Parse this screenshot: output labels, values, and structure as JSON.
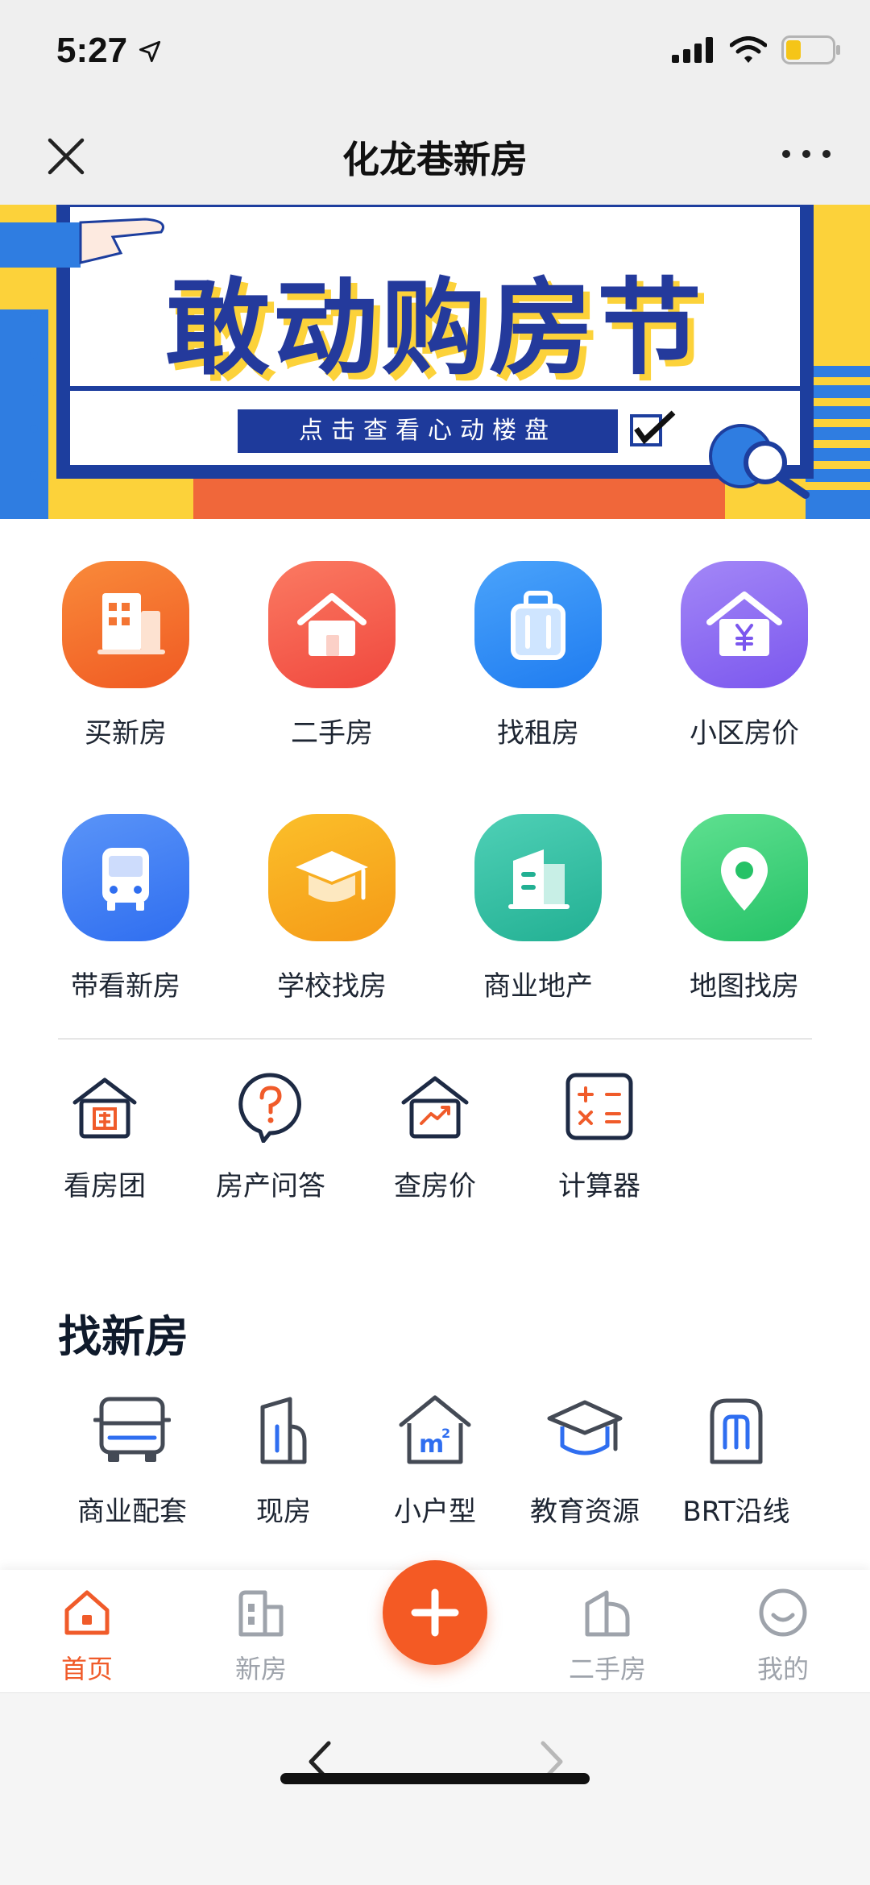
{
  "status": {
    "time": "5:27"
  },
  "nav": {
    "title": "化龙巷新房"
  },
  "banner": {
    "title": "敢动购房节",
    "subtitle": "点击查看心动楼盘"
  },
  "apps": [
    {
      "label": "买新房",
      "icon": "building-icon",
      "color": "#f46a2b"
    },
    {
      "label": "二手房",
      "icon": "house-icon",
      "color": "#f4584b"
    },
    {
      "label": "找租房",
      "icon": "suitcase-icon",
      "color": "#2d8cf5"
    },
    {
      "label": "小区房价",
      "icon": "yuan-house-icon",
      "color": "#8a68f0"
    },
    {
      "label": "带看新房",
      "icon": "bus-icon",
      "color": "#3f7cf0"
    },
    {
      "label": "学校找房",
      "icon": "graduation-cap-icon",
      "color": "#f7a21b"
    },
    {
      "label": "商业地产",
      "icon": "office-building-icon",
      "color": "#2fbfa5"
    },
    {
      "label": "地图找房",
      "icon": "map-pin-icon",
      "color": "#2fcf78"
    }
  ],
  "tools": [
    {
      "label": "看房团",
      "icon": "group-house-icon"
    },
    {
      "label": "房产问答",
      "icon": "question-bubble-icon"
    },
    {
      "label": "查房价",
      "icon": "price-trend-house-icon"
    },
    {
      "label": "计算器",
      "icon": "calculator-icon"
    }
  ],
  "find_section": {
    "title": "找新房",
    "items": [
      {
        "label": "商业配套",
        "icon": "bus-outline-icon"
      },
      {
        "label": "现房",
        "icon": "building-outline-icon"
      },
      {
        "label": "小户型",
        "icon": "m2-house-icon"
      },
      {
        "label": "教育资源",
        "icon": "graduation-outline-icon"
      },
      {
        "label": "BRT沿线",
        "icon": "brt-icon"
      }
    ]
  },
  "tabs": [
    {
      "label": "首页",
      "icon": "home-icon",
      "active": true
    },
    {
      "label": "新房",
      "icon": "new-house-icon",
      "active": false
    },
    {
      "label": "二手房",
      "icon": "second-house-icon",
      "active": false
    },
    {
      "label": "我的",
      "icon": "smile-icon",
      "active": false
    }
  ],
  "colors": {
    "accent": "#f05b2a",
    "tab_inactive": "#9ea3ab"
  }
}
